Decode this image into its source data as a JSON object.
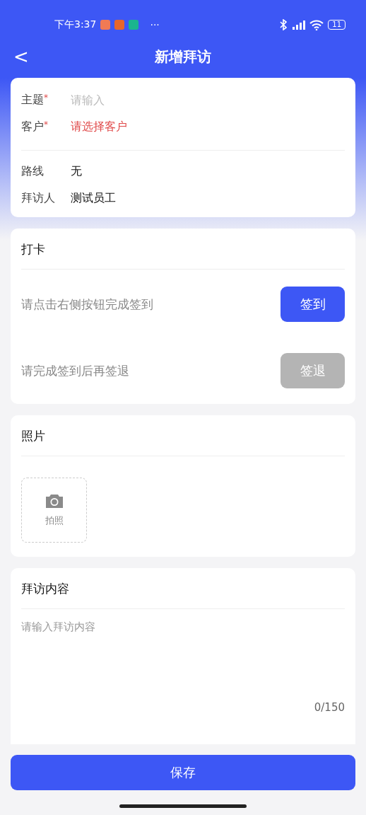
{
  "status_bar": {
    "time": "下午3:37",
    "more": "···",
    "battery": "11"
  },
  "header": {
    "back": "<",
    "title": "新增拜访"
  },
  "basic_info": {
    "fields": [
      {
        "kind": "input",
        "label": "主题",
        "required_mark": "*",
        "placeholder": "请输入"
      },
      {
        "kind": "select",
        "label": "客户",
        "required_mark": "*",
        "value": "请选择客户"
      },
      {
        "kind": "divider"
      },
      {
        "kind": "text",
        "label": "路线",
        "value": "无"
      },
      {
        "kind": "text",
        "label": "拜访人",
        "value": "测试员工"
      }
    ]
  },
  "check_in": {
    "title": "打卡",
    "rows": [
      {
        "hint": "请点击右侧按钮完成签到",
        "button": "签到",
        "disabled": false
      },
      {
        "hint": "请完成签到后再签退",
        "button": "签退",
        "disabled": true
      }
    ]
  },
  "photos": {
    "title": "照片",
    "upload_label": "拍照"
  },
  "visit_content": {
    "title": "拜访内容",
    "placeholder": "请输入拜访内容",
    "counter": "0/150"
  },
  "save_button": "保存"
}
